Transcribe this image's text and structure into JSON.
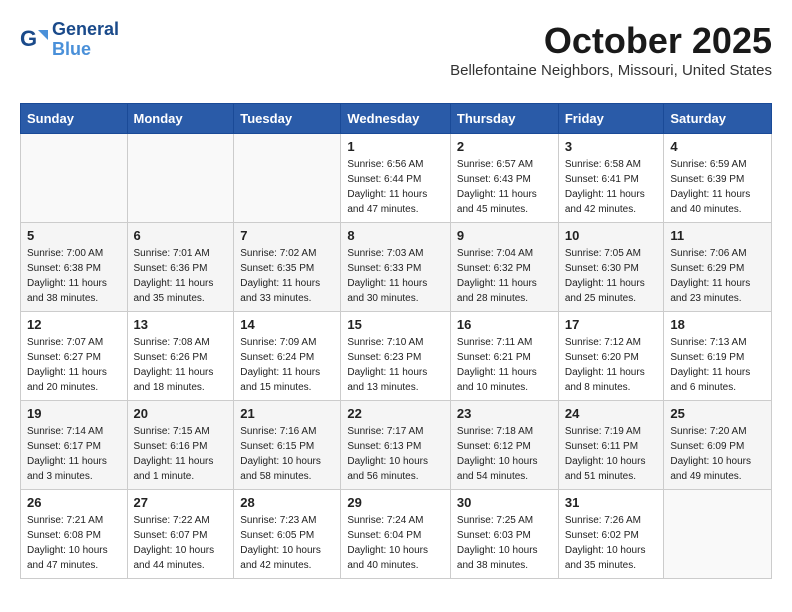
{
  "header": {
    "logo_line1": "General",
    "logo_line2": "Blue",
    "month_title": "October 2025",
    "location": "Bellefontaine Neighbors, Missouri, United States"
  },
  "days_of_week": [
    "Sunday",
    "Monday",
    "Tuesday",
    "Wednesday",
    "Thursday",
    "Friday",
    "Saturday"
  ],
  "weeks": [
    [
      {
        "day": "",
        "info": ""
      },
      {
        "day": "",
        "info": ""
      },
      {
        "day": "",
        "info": ""
      },
      {
        "day": "1",
        "info": "Sunrise: 6:56 AM\nSunset: 6:44 PM\nDaylight: 11 hours\nand 47 minutes."
      },
      {
        "day": "2",
        "info": "Sunrise: 6:57 AM\nSunset: 6:43 PM\nDaylight: 11 hours\nand 45 minutes."
      },
      {
        "day": "3",
        "info": "Sunrise: 6:58 AM\nSunset: 6:41 PM\nDaylight: 11 hours\nand 42 minutes."
      },
      {
        "day": "4",
        "info": "Sunrise: 6:59 AM\nSunset: 6:39 PM\nDaylight: 11 hours\nand 40 minutes."
      }
    ],
    [
      {
        "day": "5",
        "info": "Sunrise: 7:00 AM\nSunset: 6:38 PM\nDaylight: 11 hours\nand 38 minutes."
      },
      {
        "day": "6",
        "info": "Sunrise: 7:01 AM\nSunset: 6:36 PM\nDaylight: 11 hours\nand 35 minutes."
      },
      {
        "day": "7",
        "info": "Sunrise: 7:02 AM\nSunset: 6:35 PM\nDaylight: 11 hours\nand 33 minutes."
      },
      {
        "day": "8",
        "info": "Sunrise: 7:03 AM\nSunset: 6:33 PM\nDaylight: 11 hours\nand 30 minutes."
      },
      {
        "day": "9",
        "info": "Sunrise: 7:04 AM\nSunset: 6:32 PM\nDaylight: 11 hours\nand 28 minutes."
      },
      {
        "day": "10",
        "info": "Sunrise: 7:05 AM\nSunset: 6:30 PM\nDaylight: 11 hours\nand 25 minutes."
      },
      {
        "day": "11",
        "info": "Sunrise: 7:06 AM\nSunset: 6:29 PM\nDaylight: 11 hours\nand 23 minutes."
      }
    ],
    [
      {
        "day": "12",
        "info": "Sunrise: 7:07 AM\nSunset: 6:27 PM\nDaylight: 11 hours\nand 20 minutes."
      },
      {
        "day": "13",
        "info": "Sunrise: 7:08 AM\nSunset: 6:26 PM\nDaylight: 11 hours\nand 18 minutes."
      },
      {
        "day": "14",
        "info": "Sunrise: 7:09 AM\nSunset: 6:24 PM\nDaylight: 11 hours\nand 15 minutes."
      },
      {
        "day": "15",
        "info": "Sunrise: 7:10 AM\nSunset: 6:23 PM\nDaylight: 11 hours\nand 13 minutes."
      },
      {
        "day": "16",
        "info": "Sunrise: 7:11 AM\nSunset: 6:21 PM\nDaylight: 11 hours\nand 10 minutes."
      },
      {
        "day": "17",
        "info": "Sunrise: 7:12 AM\nSunset: 6:20 PM\nDaylight: 11 hours\nand 8 minutes."
      },
      {
        "day": "18",
        "info": "Sunrise: 7:13 AM\nSunset: 6:19 PM\nDaylight: 11 hours\nand 6 minutes."
      }
    ],
    [
      {
        "day": "19",
        "info": "Sunrise: 7:14 AM\nSunset: 6:17 PM\nDaylight: 11 hours\nand 3 minutes."
      },
      {
        "day": "20",
        "info": "Sunrise: 7:15 AM\nSunset: 6:16 PM\nDaylight: 11 hours\nand 1 minute."
      },
      {
        "day": "21",
        "info": "Sunrise: 7:16 AM\nSunset: 6:15 PM\nDaylight: 10 hours\nand 58 minutes."
      },
      {
        "day": "22",
        "info": "Sunrise: 7:17 AM\nSunset: 6:13 PM\nDaylight: 10 hours\nand 56 minutes."
      },
      {
        "day": "23",
        "info": "Sunrise: 7:18 AM\nSunset: 6:12 PM\nDaylight: 10 hours\nand 54 minutes."
      },
      {
        "day": "24",
        "info": "Sunrise: 7:19 AM\nSunset: 6:11 PM\nDaylight: 10 hours\nand 51 minutes."
      },
      {
        "day": "25",
        "info": "Sunrise: 7:20 AM\nSunset: 6:09 PM\nDaylight: 10 hours\nand 49 minutes."
      }
    ],
    [
      {
        "day": "26",
        "info": "Sunrise: 7:21 AM\nSunset: 6:08 PM\nDaylight: 10 hours\nand 47 minutes."
      },
      {
        "day": "27",
        "info": "Sunrise: 7:22 AM\nSunset: 6:07 PM\nDaylight: 10 hours\nand 44 minutes."
      },
      {
        "day": "28",
        "info": "Sunrise: 7:23 AM\nSunset: 6:05 PM\nDaylight: 10 hours\nand 42 minutes."
      },
      {
        "day": "29",
        "info": "Sunrise: 7:24 AM\nSunset: 6:04 PM\nDaylight: 10 hours\nand 40 minutes."
      },
      {
        "day": "30",
        "info": "Sunrise: 7:25 AM\nSunset: 6:03 PM\nDaylight: 10 hours\nand 38 minutes."
      },
      {
        "day": "31",
        "info": "Sunrise: 7:26 AM\nSunset: 6:02 PM\nDaylight: 10 hours\nand 35 minutes."
      },
      {
        "day": "",
        "info": ""
      }
    ]
  ]
}
